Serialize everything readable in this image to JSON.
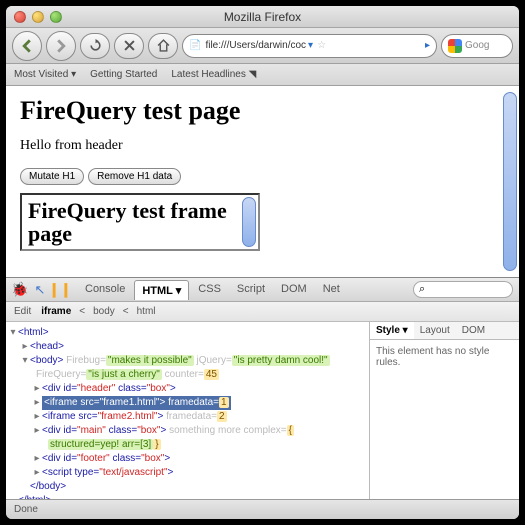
{
  "window": {
    "title": "Mozilla Firefox"
  },
  "address": {
    "url": "file:///Users/darwin/coc",
    "search_placeholder": "Goog"
  },
  "bookmarks": {
    "most_visited": "Most Visited",
    "getting_started": "Getting Started",
    "latest_headlines": "Latest Headlines"
  },
  "page": {
    "h1": "FireQuery test page",
    "para": "Hello from header",
    "mutate_btn": "Mutate H1",
    "remove_btn": "Remove H1 data",
    "iframe_h1": "FireQuery test frame page"
  },
  "firebug": {
    "tabs": {
      "console": "Console",
      "html": "HTML",
      "css": "CSS",
      "script": "Script",
      "dom": "DOM",
      "net": "Net"
    },
    "edit": "Edit",
    "crumbs": [
      "iframe",
      "body",
      "html"
    ],
    "side_tabs": {
      "style": "Style",
      "layout": "Layout",
      "dom": "DOM"
    },
    "side_msg": "This element has no style rules.",
    "search_icon": "⌕",
    "html_tree": {
      "html_open": "<html>",
      "head": "<head>",
      "body_open": "<body>",
      "firebug_k": "Firebug=",
      "firebug_v": "\"makes it possible\"",
      "jquery_k": "jQuery=",
      "jquery_v": "\"is pretty damn cool!\"",
      "firequery_k": "FireQuery=",
      "firequery_v": "\"is just a cherry\"",
      "counter_k": "counter=",
      "counter_v": "45",
      "div_header": "<div id=\"header\" class=\"box\">",
      "iframe1": "<iframe src=\"frame1.html\">",
      "iframe1_k": "framedata=",
      "iframe1_v": "1",
      "iframe2": "<iframe src=\"frame2.html\">",
      "iframe2_k": "framedata=",
      "iframe2_v": "2",
      "div_main": "<div id=\"main\" class=\"box\">",
      "main_k": "something more complex=",
      "main_v1": "structured=",
      "main_v1b": "yep!",
      "main_v2": "arr=",
      "main_v2b": "[3]",
      "div_footer": "<div id=\"footer\" class=\"box\">",
      "script": "<script type=\"text/javascript\">",
      "body_close": "</body>",
      "html_close": "</html>"
    }
  },
  "status": "Done"
}
